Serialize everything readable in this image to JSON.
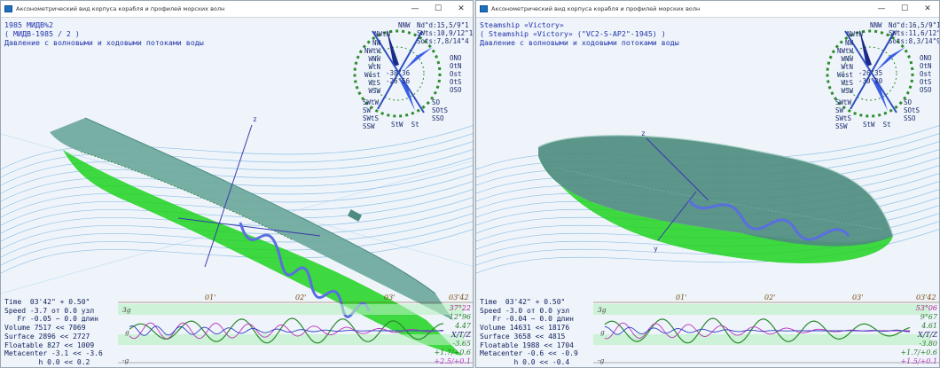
{
  "windows": [
    {
      "title": "Аксонометрический вид корпуса корабля и профилей морских волн",
      "header": [
        "1985 МИДВ%2",
        "( МИДВ-1985 / 2 )",
        "Давление с волновыми и ходовыми потоками воды"
      ],
      "rose": {
        "nw_top": "NNW",
        "nwtn": "NWtN",
        "rl1": "Nd\"d:15,5/9\"1",
        "rl2": "SWts:10,9/12\"1",
        "rl3": "Sots:7,8/14\"4",
        "left": [
          "NW",
          "NWtW",
          "WNW",
          "WtN",
          "West",
          "WtS",
          "WSW"
        ],
        "right": [
          "ONO",
          "OtN",
          "Ost",
          "OtS",
          "OSO"
        ],
        "bottom_left": [
          "SWtW",
          "SW",
          "SWtS",
          "SSW"
        ],
        "bottom_right": [
          "SO",
          "SOtS",
          "SSO"
        ],
        "bottom_mid": "StW  St",
        "center": [
          "-38°36",
          "-26°56"
        ]
      },
      "stats": [
        "Time  03'42\" + 0.50\"",
        "Speed -3.7 от 0.0 узл",
        "   Fr -0.05 ~ 0.0 длин",
        "Volume 7517 << 7069",
        "Surface 2896 << 2727",
        "Floatable 827 << 1009",
        "Metacenter -3.1 << -3.6",
        "        h 0.0 << 0.2"
      ],
      "timeline": [
        "01'",
        "02'",
        "03'",
        "03'42"
      ],
      "right_vals": [
        {
          "t": "37°22",
          "c": "#b02090"
        },
        {
          "t": "12°96",
          "c": "#2a7a2a"
        },
        {
          "t": "4.47",
          "c": "#2a7a2a"
        },
        {
          "t": "X/T/Z",
          "c": "#202060"
        },
        {
          "t": "-3.65",
          "c": "#2a7a2a"
        },
        {
          "t": "+1.7/+0.6",
          "c": "#2a7a2a"
        },
        {
          "t": "+2.5/+0.1",
          "c": "#c030c0"
        }
      ],
      "scale_marks": [
        "3g",
        "g",
        "-g"
      ],
      "axis_z": "z"
    },
    {
      "title": "Аксонометрический вид корпуса корабля и профилей морских волн",
      "header": [
        "Steamship «Victory»",
        "( Steamship «Victory» (\"VC2-S-AP2\"-1945) )",
        "Давление с волновыми и ходовыми потоками воды"
      ],
      "rose": {
        "nw_top": "NNW",
        "nwtn": "NWtN",
        "rl1": "Nd\"d:16,5/9\"1",
        "rl2": "SWts:11,6/12\"5",
        "rl3": "Sots:8,3/14\"9",
        "left": [
          "NW",
          "NWtW",
          "WNW",
          "WtN",
          "West",
          "WtS",
          "WSW"
        ],
        "right": [
          "ONO",
          "OtN",
          "Ost",
          "OtS",
          "OSO"
        ],
        "bottom_left": [
          "SWtW",
          "SW",
          "SWtS",
          "SSW"
        ],
        "bottom_right": [
          "SO",
          "SOtS",
          "SSO"
        ],
        "bottom_mid": "StW  St",
        "center": [
          "-26°35",
          "-30°30"
        ]
      },
      "stats": [
        "Time  03'42\" + 0.50\"",
        "Speed -3.0 от 0.0 узл",
        "   Fr -0.04 ~ 0.0 длин",
        "Volume 14631 << 18176",
        "Surface 3658 << 4815",
        "Floatable 1988 << 1704",
        "Metacenter -0.6 << -0.9",
        "        h 0.0 << -0.4"
      ],
      "timeline": [
        "01'",
        "02'",
        "03'",
        "03'42"
      ],
      "right_vals": [
        {
          "t": "53°06",
          "c": "#b02090"
        },
        {
          "t": "9°67",
          "c": "#2a7a2a"
        },
        {
          "t": "4.61",
          "c": "#2a7a2a"
        },
        {
          "t": "X/T/Z",
          "c": "#202060"
        },
        {
          "t": "-3.80",
          "c": "#2a7a2a"
        },
        {
          "t": "+1.7/+0.6",
          "c": "#2a7a2a"
        },
        {
          "t": "+1.5/+0.1",
          "c": "#c030c0"
        }
      ],
      "scale_marks": [
        "3g",
        "g",
        "-g"
      ],
      "axis_z": "z",
      "axis_y": "y"
    }
  ],
  "icons": {
    "min": "minimize-icon",
    "max": "maximize-icon",
    "close": "close-icon"
  },
  "button_glyphs": {
    "min": "—",
    "max": "☐",
    "close": "✕"
  },
  "colors": {
    "hull_green": "#1fd21f",
    "hull_teal": "#6aa79a",
    "wave_blue": "#5a6ee0",
    "text_blue": "#2233aa"
  }
}
